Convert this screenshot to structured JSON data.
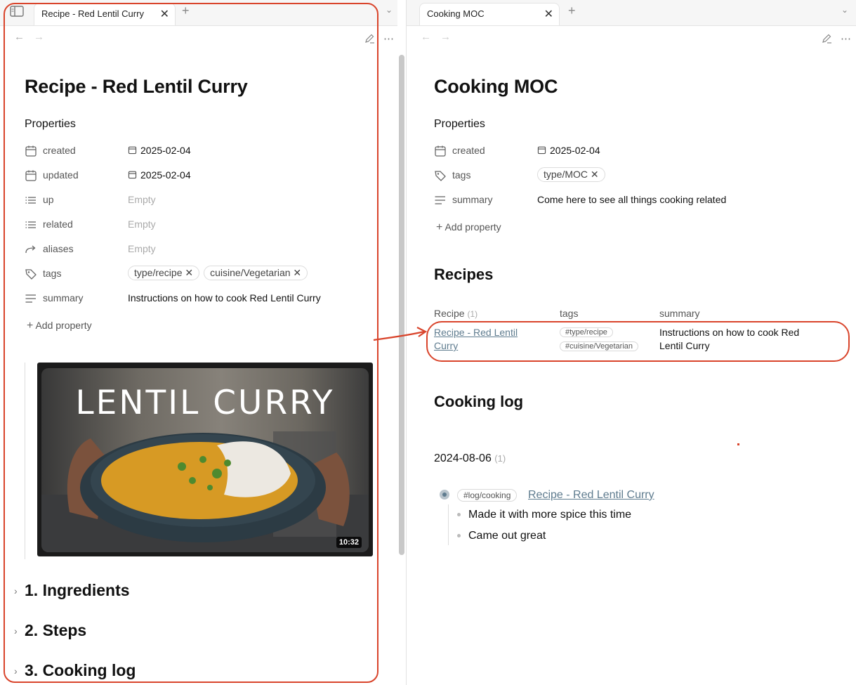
{
  "left": {
    "tab_title": "Recipe - Red Lentil Curry",
    "title": "Recipe - Red Lentil Curry",
    "properties_heading": "Properties",
    "properties": [
      {
        "key": "created",
        "value": "2025-02-04"
      },
      {
        "key": "updated",
        "value": "2025-02-04"
      },
      {
        "key": "up",
        "value": "Empty"
      },
      {
        "key": "related",
        "value": "Empty"
      },
      {
        "key": "aliases",
        "value": "Empty"
      },
      {
        "key": "tags",
        "tags": [
          "type/recipe",
          "cuisine/Vegetarian"
        ]
      },
      {
        "key": "summary",
        "value": "Instructions on how to cook Red Lentil Curry"
      }
    ],
    "add_property": "Add property",
    "video": {
      "title": "LENTIL CURRY",
      "duration": "10:32"
    },
    "sections": [
      "1. Ingredients",
      "2. Steps",
      "3. Cooking log"
    ]
  },
  "right": {
    "tab_title": "Cooking MOC",
    "title": "Cooking MOC",
    "properties_heading": "Properties",
    "properties": [
      {
        "key": "created",
        "value": "2025-02-04"
      },
      {
        "key": "tags",
        "tags": [
          "type/MOC"
        ]
      },
      {
        "key": "summary",
        "value": "Come here to see all things cooking related"
      }
    ],
    "add_property": "Add property",
    "recipes_heading": "Recipes",
    "table": {
      "headers": [
        "Recipe",
        "tags",
        "summary"
      ],
      "count": "(1)",
      "rows": [
        {
          "recipe_line1": "Recipe - Red Lentil",
          "recipe_line2": "Curry",
          "tags": [
            "#type/recipe",
            "#cuisine/Vegetarian"
          ],
          "summary_line1": "Instructions on how to cook Red",
          "summary_line2": "Lentil Curry"
        }
      ]
    },
    "log_heading": "Cooking log",
    "log_date": "2024-08-06",
    "log_count": "(1)",
    "log_tag": "#log/cooking",
    "log_link": "Recipe - Red Lentil Curry",
    "log_items": [
      "Made it with more spice this time",
      "Came out great"
    ]
  },
  "colors": {
    "annotation": "#d9442b",
    "link": "#5f7c8f"
  }
}
